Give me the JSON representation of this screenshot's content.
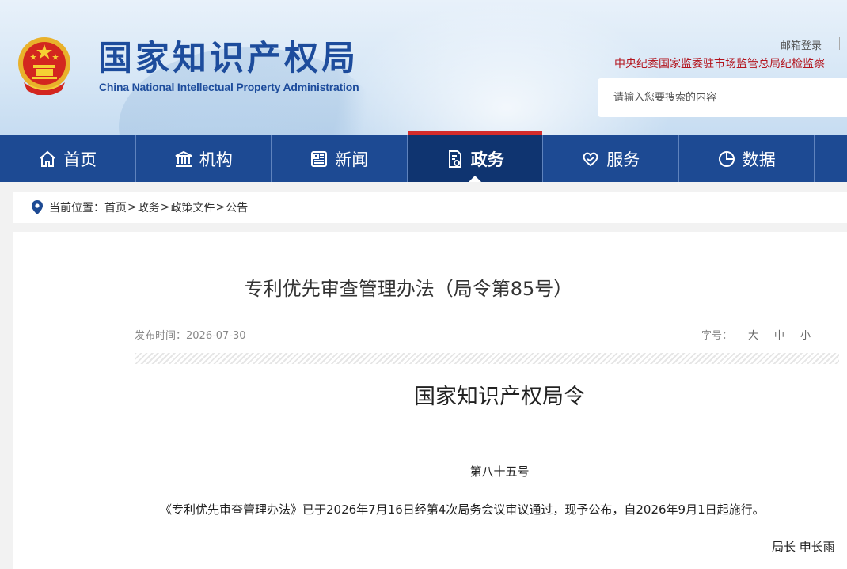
{
  "header": {
    "logo_cn": "国家知识产权局",
    "logo_en": "China National Intellectual Property Administration",
    "mail_login": "邮箱登录",
    "discipline_link": "中央纪委国家监委驻市场监管总局纪检监察",
    "search_placeholder": "请输入您要搜索的内容"
  },
  "nav": {
    "items": [
      {
        "label": "首页",
        "icon": "home-icon"
      },
      {
        "label": "机构",
        "icon": "institution-icon"
      },
      {
        "label": "新闻",
        "icon": "news-icon"
      },
      {
        "label": "政务",
        "icon": "government-affairs-icon",
        "active": true
      },
      {
        "label": "服务",
        "icon": "heart-hand-icon"
      },
      {
        "label": "数据",
        "icon": "pie-chart-icon"
      }
    ]
  },
  "breadcrumb": {
    "prefix": "当前位置：",
    "items": [
      "首页",
      "政务",
      "政策文件",
      "公告"
    ],
    "separator": ">"
  },
  "article": {
    "title": "专利优先审查管理办法（局令第85号）",
    "publish_time": "发布时间：2026-07-30",
    "font_size_label": "字号：",
    "font_size_options": [
      "大",
      "中",
      "小"
    ],
    "order_heading": "国家知识产权局令",
    "order_number": "第八十五号",
    "body": "《专利优先审查管理办法》已于2026年7月16日经第4次局务会议审议通过，现予公布，自2026年9月1日起施行。",
    "signer": "局长  申长雨"
  },
  "colors": {
    "nav_bg": "#1d4a93",
    "nav_active_bg": "#0f3470",
    "nav_active_accent": "#d42c2c",
    "logo_blue": "#1d4c9c",
    "discipline_red": "#b3141d"
  }
}
